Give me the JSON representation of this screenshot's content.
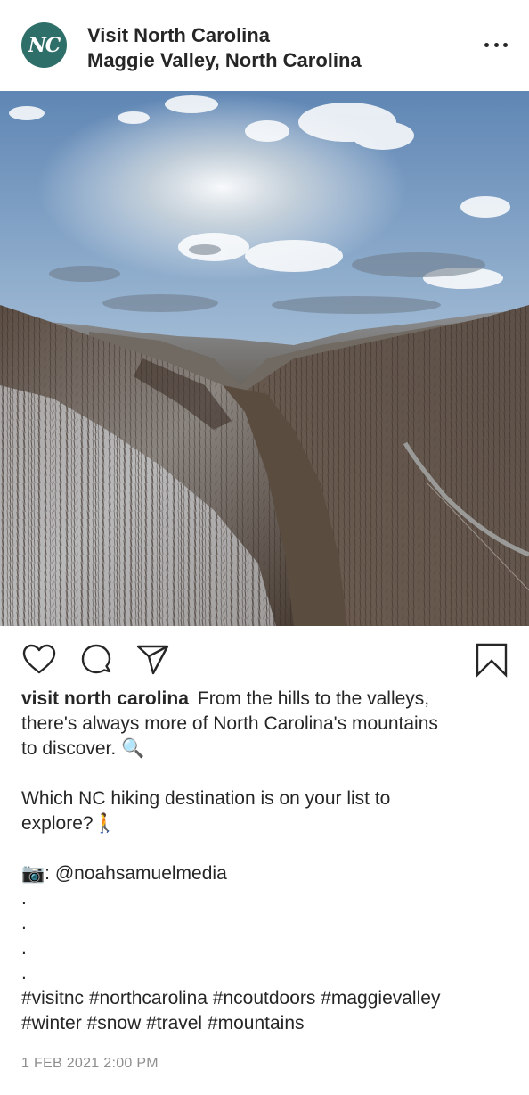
{
  "header": {
    "avatar_text": "NC",
    "account_name": "Visit North Carolina",
    "location": "Maggie Valley, North Carolina",
    "more_icon": "ellipsis-icon"
  },
  "actions": {
    "like_icon": "heart-icon",
    "comment_icon": "comment-bubble-icon",
    "share_icon": "paper-plane-icon",
    "save_icon": "bookmark-icon"
  },
  "caption": {
    "username": "visit north carolina",
    "line1_text": "From the hills to the valleys,",
    "line2": "there's always more of North Carolina's mountains",
    "line3": "to discover. 🔍",
    "line4": "Which NC hiking destination is on your list to",
    "line5": "explore?🚶",
    "line6": "📷: @noahsamuelmedia",
    "dot1": ".",
    "dot2": ".",
    "dot3": ".",
    "dot4": ".",
    "hashtags1": "#visitnc #northcarolina #ncoutdoors #maggievalley",
    "hashtags2": "#winter #snow #travel #mountains"
  },
  "timestamp": "1 FEB 2021 2:00 PM",
  "colors": {
    "avatar_bg": "#2f6f6a",
    "text": "#262626",
    "muted": "#8e8e8e"
  }
}
